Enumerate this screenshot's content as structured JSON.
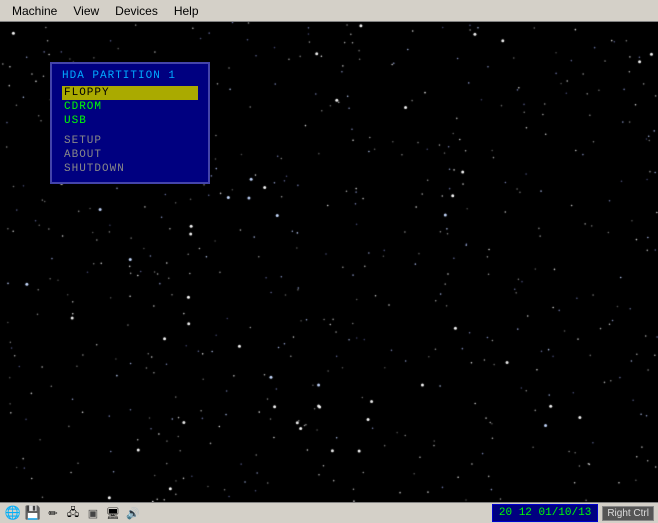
{
  "menubar": {
    "items": [
      {
        "label": "Machine",
        "id": "machine"
      },
      {
        "label": "View",
        "id": "view"
      },
      {
        "label": "Devices",
        "id": "devices"
      },
      {
        "label": "Help",
        "id": "help"
      }
    ]
  },
  "bios": {
    "title": "HDA PARTITION 1",
    "items": [
      {
        "label": "FLOPPY",
        "selected": true,
        "id": "floppy"
      },
      {
        "label": "CDROM",
        "selected": false,
        "id": "cdrom"
      },
      {
        "label": "USB",
        "selected": false,
        "id": "usb"
      },
      {
        "label": "",
        "divider": true
      },
      {
        "label": "SETUP",
        "selected": false,
        "id": "setup"
      },
      {
        "label": "ABOUT",
        "selected": false,
        "id": "about"
      },
      {
        "label": "SHUTDOWN",
        "selected": false,
        "id": "shutdown"
      }
    ]
  },
  "statusbar": {
    "time_display": "20 12  01/10/13",
    "right_ctrl_label": "Right Ctrl",
    "icons": [
      {
        "name": "globe-icon",
        "symbol": "🌐"
      },
      {
        "name": "floppy-icon",
        "symbol": "💾"
      },
      {
        "name": "edit-icon",
        "symbol": "✏"
      },
      {
        "name": "network-icon",
        "symbol": "🖧"
      },
      {
        "name": "usb-icon",
        "symbol": "⊡"
      },
      {
        "name": "display-icon",
        "symbol": "🖥"
      },
      {
        "name": "audio-icon",
        "symbol": "🔊"
      }
    ]
  }
}
